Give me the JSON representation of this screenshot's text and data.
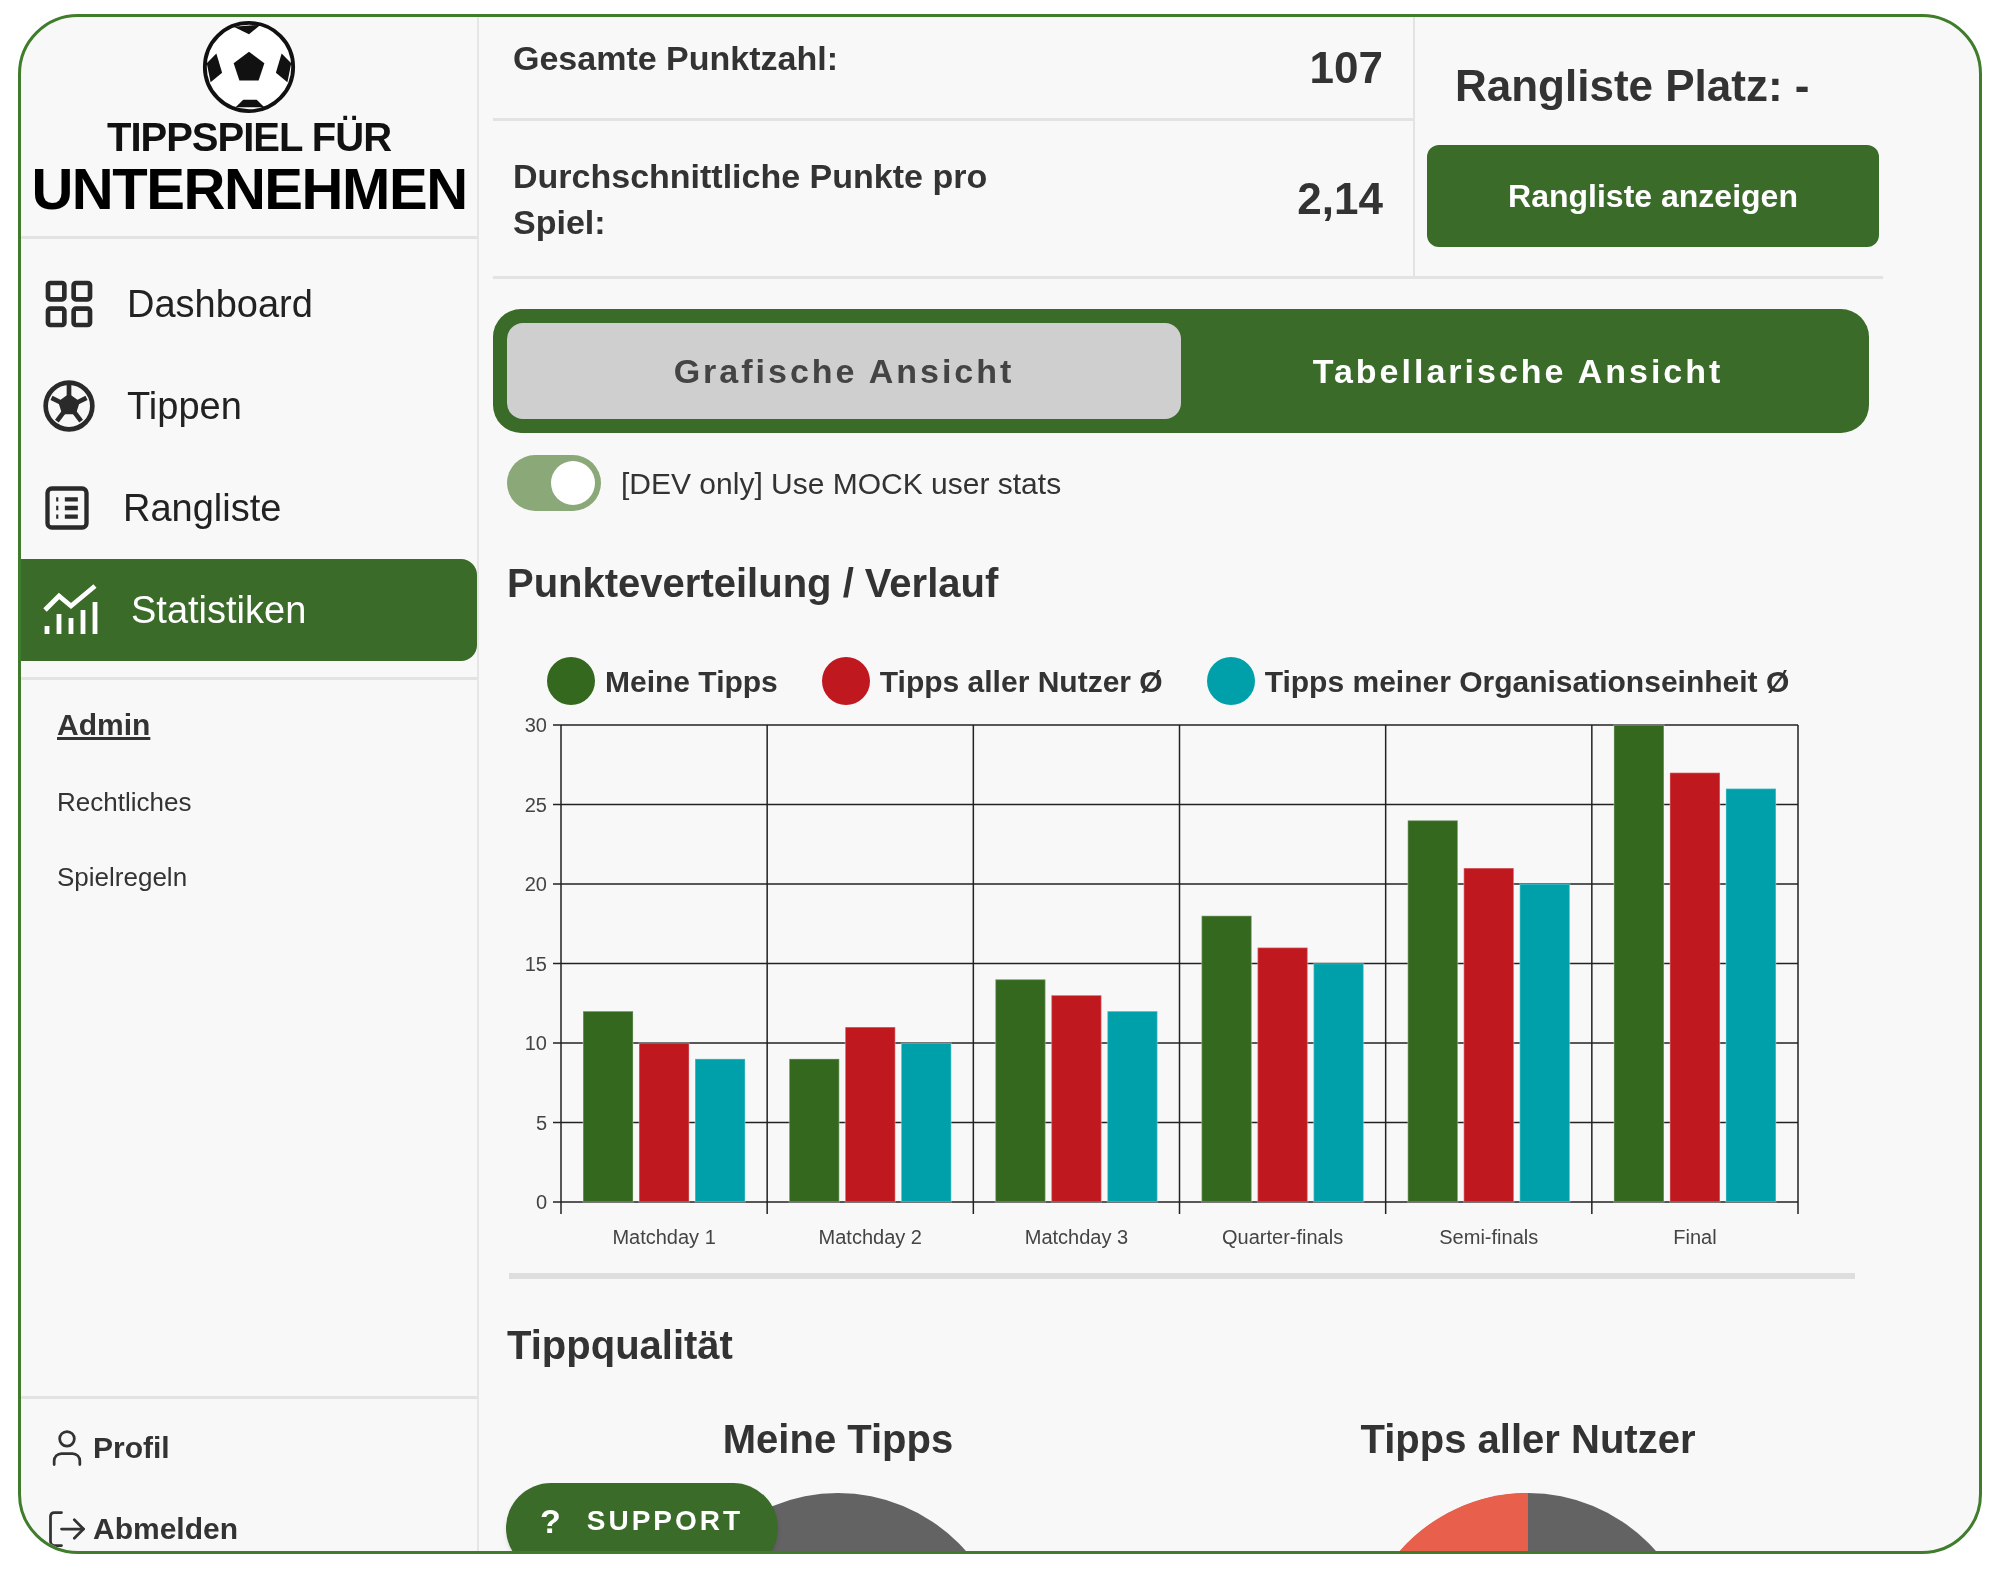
{
  "logo": {
    "line_1": "TIPPSPIEL FÜR",
    "line_2": "UNTERNEHMEN"
  },
  "sidebar": {
    "items": [
      {
        "label": "Dashboard",
        "selected": false
      },
      {
        "label": "Tippen",
        "selected": false
      },
      {
        "label": "Rangliste",
        "selected": false
      },
      {
        "label": "Statistiken",
        "selected": true
      }
    ],
    "links": [
      {
        "label": "Admin",
        "kind": "heading"
      },
      {
        "label": "Rechtliches",
        "kind": "link"
      },
      {
        "label": "Spielregeln",
        "kind": "link"
      }
    ],
    "footer": [
      {
        "label": "Profil"
      },
      {
        "label": "Abmelden"
      }
    ]
  },
  "stats": [
    {
      "label": "Gesamte Punktzahl:",
      "value": "107"
    },
    {
      "label": "Durchschnittliche Punkte pro Spiel:",
      "value": "2,14"
    }
  ],
  "rank": {
    "label": "Rangliste Platz: -",
    "button": "Rangliste anzeigen"
  },
  "tabs": [
    {
      "label": "Grafische Ansicht",
      "selected": true
    },
    {
      "label": "Tabellarische Ansicht",
      "selected": false
    }
  ],
  "mock_toggle": {
    "label": "[DEV only] Use MOCK user stats",
    "on": true
  },
  "distribution": {
    "title": "Punkteverteilung / Verlauf",
    "chart_data": {
      "type": "bar",
      "categories": [
        "Matchday 1",
        "Matchday 2",
        "Matchday 3",
        "Quarter-finals",
        "Semi-finals",
        "Final"
      ],
      "series": [
        {
          "name": "Meine Tipps",
          "color": "#35681f",
          "values": [
            12,
            9,
            14,
            18,
            24,
            30
          ]
        },
        {
          "name": "Tipps aller Nutzer Ø",
          "color": "#c0181f",
          "values": [
            10,
            11,
            13,
            16,
            21,
            27
          ]
        },
        {
          "name": "Tipps meiner Organisationseinheit Ø",
          "color": "#00a0aa",
          "values": [
            9,
            10,
            12,
            15,
            20,
            26
          ]
        }
      ],
      "ylim": [
        0,
        30
      ],
      "grid": true,
      "yticks": [
        0,
        5,
        10,
        15,
        20,
        25,
        30
      ]
    }
  },
  "quality": {
    "title": "Tippqualität",
    "panels": [
      {
        "title": "Meine Tipps"
      },
      {
        "title": "Tipps aller Nutzer"
      }
    ]
  },
  "support": {
    "icon": "?",
    "label": "SUPPORT"
  }
}
